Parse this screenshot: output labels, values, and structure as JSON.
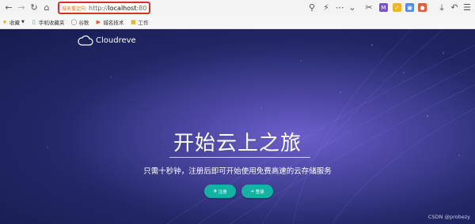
{
  "browser": {
    "url_badge": "城名重定向",
    "url_protocol": "http://",
    "url_host": "localhost",
    "url_port": ":80"
  },
  "bookmarks": [
    {
      "label": "收藏",
      "icon": "star-icon"
    },
    {
      "label": "手机收藏夹",
      "icon": "phone-icon"
    },
    {
      "label": "谷歌",
      "icon": "globe-icon"
    },
    {
      "label": "城名技术",
      "icon": "bookmark-icon"
    },
    {
      "label": "工作",
      "icon": "folder-icon"
    }
  ],
  "hero": {
    "brand": "Cloudreve",
    "headline": "开始云上之旅",
    "subtitle": "只需十秒钟，注册后即可开始使用免费高速的云存储服务",
    "register_label": "注册",
    "login_label": "登录"
  },
  "watermark": "CSDN @probezy",
  "colors": {
    "accent": "#13b3a3",
    "hero_bg": "#23296a",
    "highlight": "#d9302c"
  }
}
